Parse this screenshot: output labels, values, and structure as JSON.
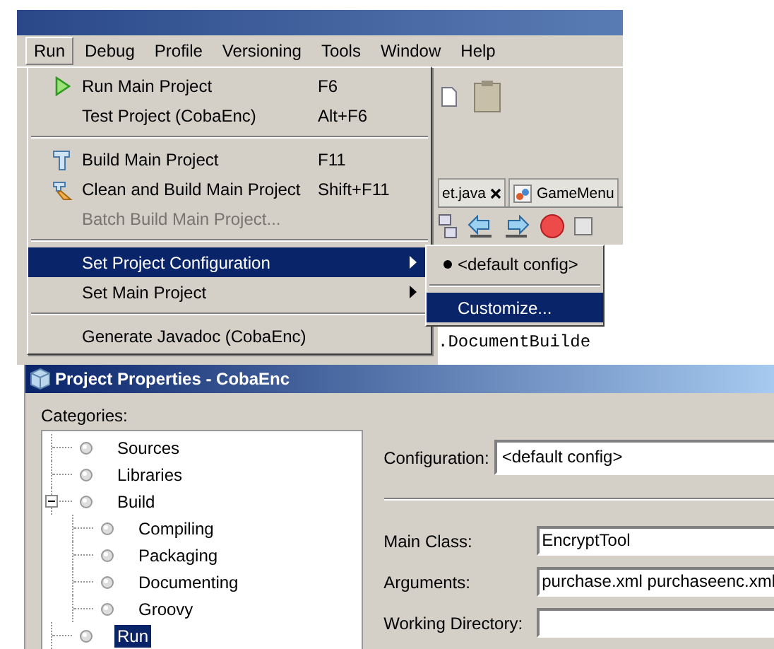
{
  "ide": {
    "menubar": [
      {
        "label": "Run",
        "selected": true
      },
      {
        "label": "Debug",
        "selected": false
      },
      {
        "label": "Profile",
        "selected": false
      },
      {
        "label": "Versioning",
        "selected": false
      },
      {
        "label": "Tools",
        "selected": false
      },
      {
        "label": "Window",
        "selected": false
      },
      {
        "label": "Help",
        "selected": false
      }
    ],
    "editor_tabs": [
      {
        "label": "et.java",
        "closable": true
      },
      {
        "label": "GameMenu",
        "closable": false
      }
    ],
    "code_lines": [
      ".DocumentBuilde"
    ],
    "run_menu": [
      {
        "kind": "item",
        "label": "Run Main Project",
        "shortcut": "F6",
        "disabled": false,
        "highlighted": false,
        "submenu": false
      },
      {
        "kind": "item",
        "label": "Test Project (CobaEnc)",
        "shortcut": "Alt+F6",
        "disabled": false,
        "highlighted": false,
        "submenu": false
      },
      {
        "kind": "separator"
      },
      {
        "kind": "item",
        "label": "Build Main Project",
        "shortcut": "F11",
        "disabled": false,
        "highlighted": false,
        "submenu": false
      },
      {
        "kind": "item",
        "label": "Clean and Build Main Project",
        "shortcut": "Shift+F11",
        "disabled": false,
        "highlighted": false,
        "submenu": false
      },
      {
        "kind": "item",
        "label": "Batch Build Main Project...",
        "disabled": true,
        "highlighted": false,
        "submenu": false
      },
      {
        "kind": "separator"
      },
      {
        "kind": "item",
        "label": "Set Project Configuration",
        "disabled": false,
        "highlighted": true,
        "submenu": true
      },
      {
        "kind": "item",
        "label": "Set Main Project",
        "disabled": false,
        "highlighted": false,
        "submenu": true
      },
      {
        "kind": "separator"
      },
      {
        "kind": "item",
        "label": "Generate Javadoc (CobaEnc)",
        "disabled": false,
        "highlighted": false,
        "submenu": false
      }
    ],
    "config_submenu": [
      {
        "kind": "radio",
        "label": "<default config>",
        "selected": true,
        "highlighted": false
      },
      {
        "kind": "separator"
      },
      {
        "kind": "item",
        "label": "Customize...",
        "highlighted": true
      }
    ]
  },
  "dialog": {
    "title": "Project Properties - CobaEnc",
    "categories_label": "Categories:",
    "categories": [
      {
        "label": "Sources",
        "selected": false
      },
      {
        "label": "Libraries",
        "selected": false
      },
      {
        "label": "Build",
        "selected": false,
        "expanded": true,
        "children": [
          {
            "label": "Compiling",
            "selected": false
          },
          {
            "label": "Packaging",
            "selected": false
          },
          {
            "label": "Documenting",
            "selected": false
          },
          {
            "label": "Groovy",
            "selected": false
          }
        ]
      },
      {
        "label": "Run",
        "selected": true
      }
    ],
    "configuration": {
      "label": "Configuration:",
      "value": "<default config>"
    },
    "fields": [
      {
        "label": "Main Class:",
        "value": "EncryptTool"
      },
      {
        "label": "Arguments:",
        "value": "purchase.xml purchaseenc.xml"
      },
      {
        "label": "Working Directory:"
      }
    ]
  }
}
